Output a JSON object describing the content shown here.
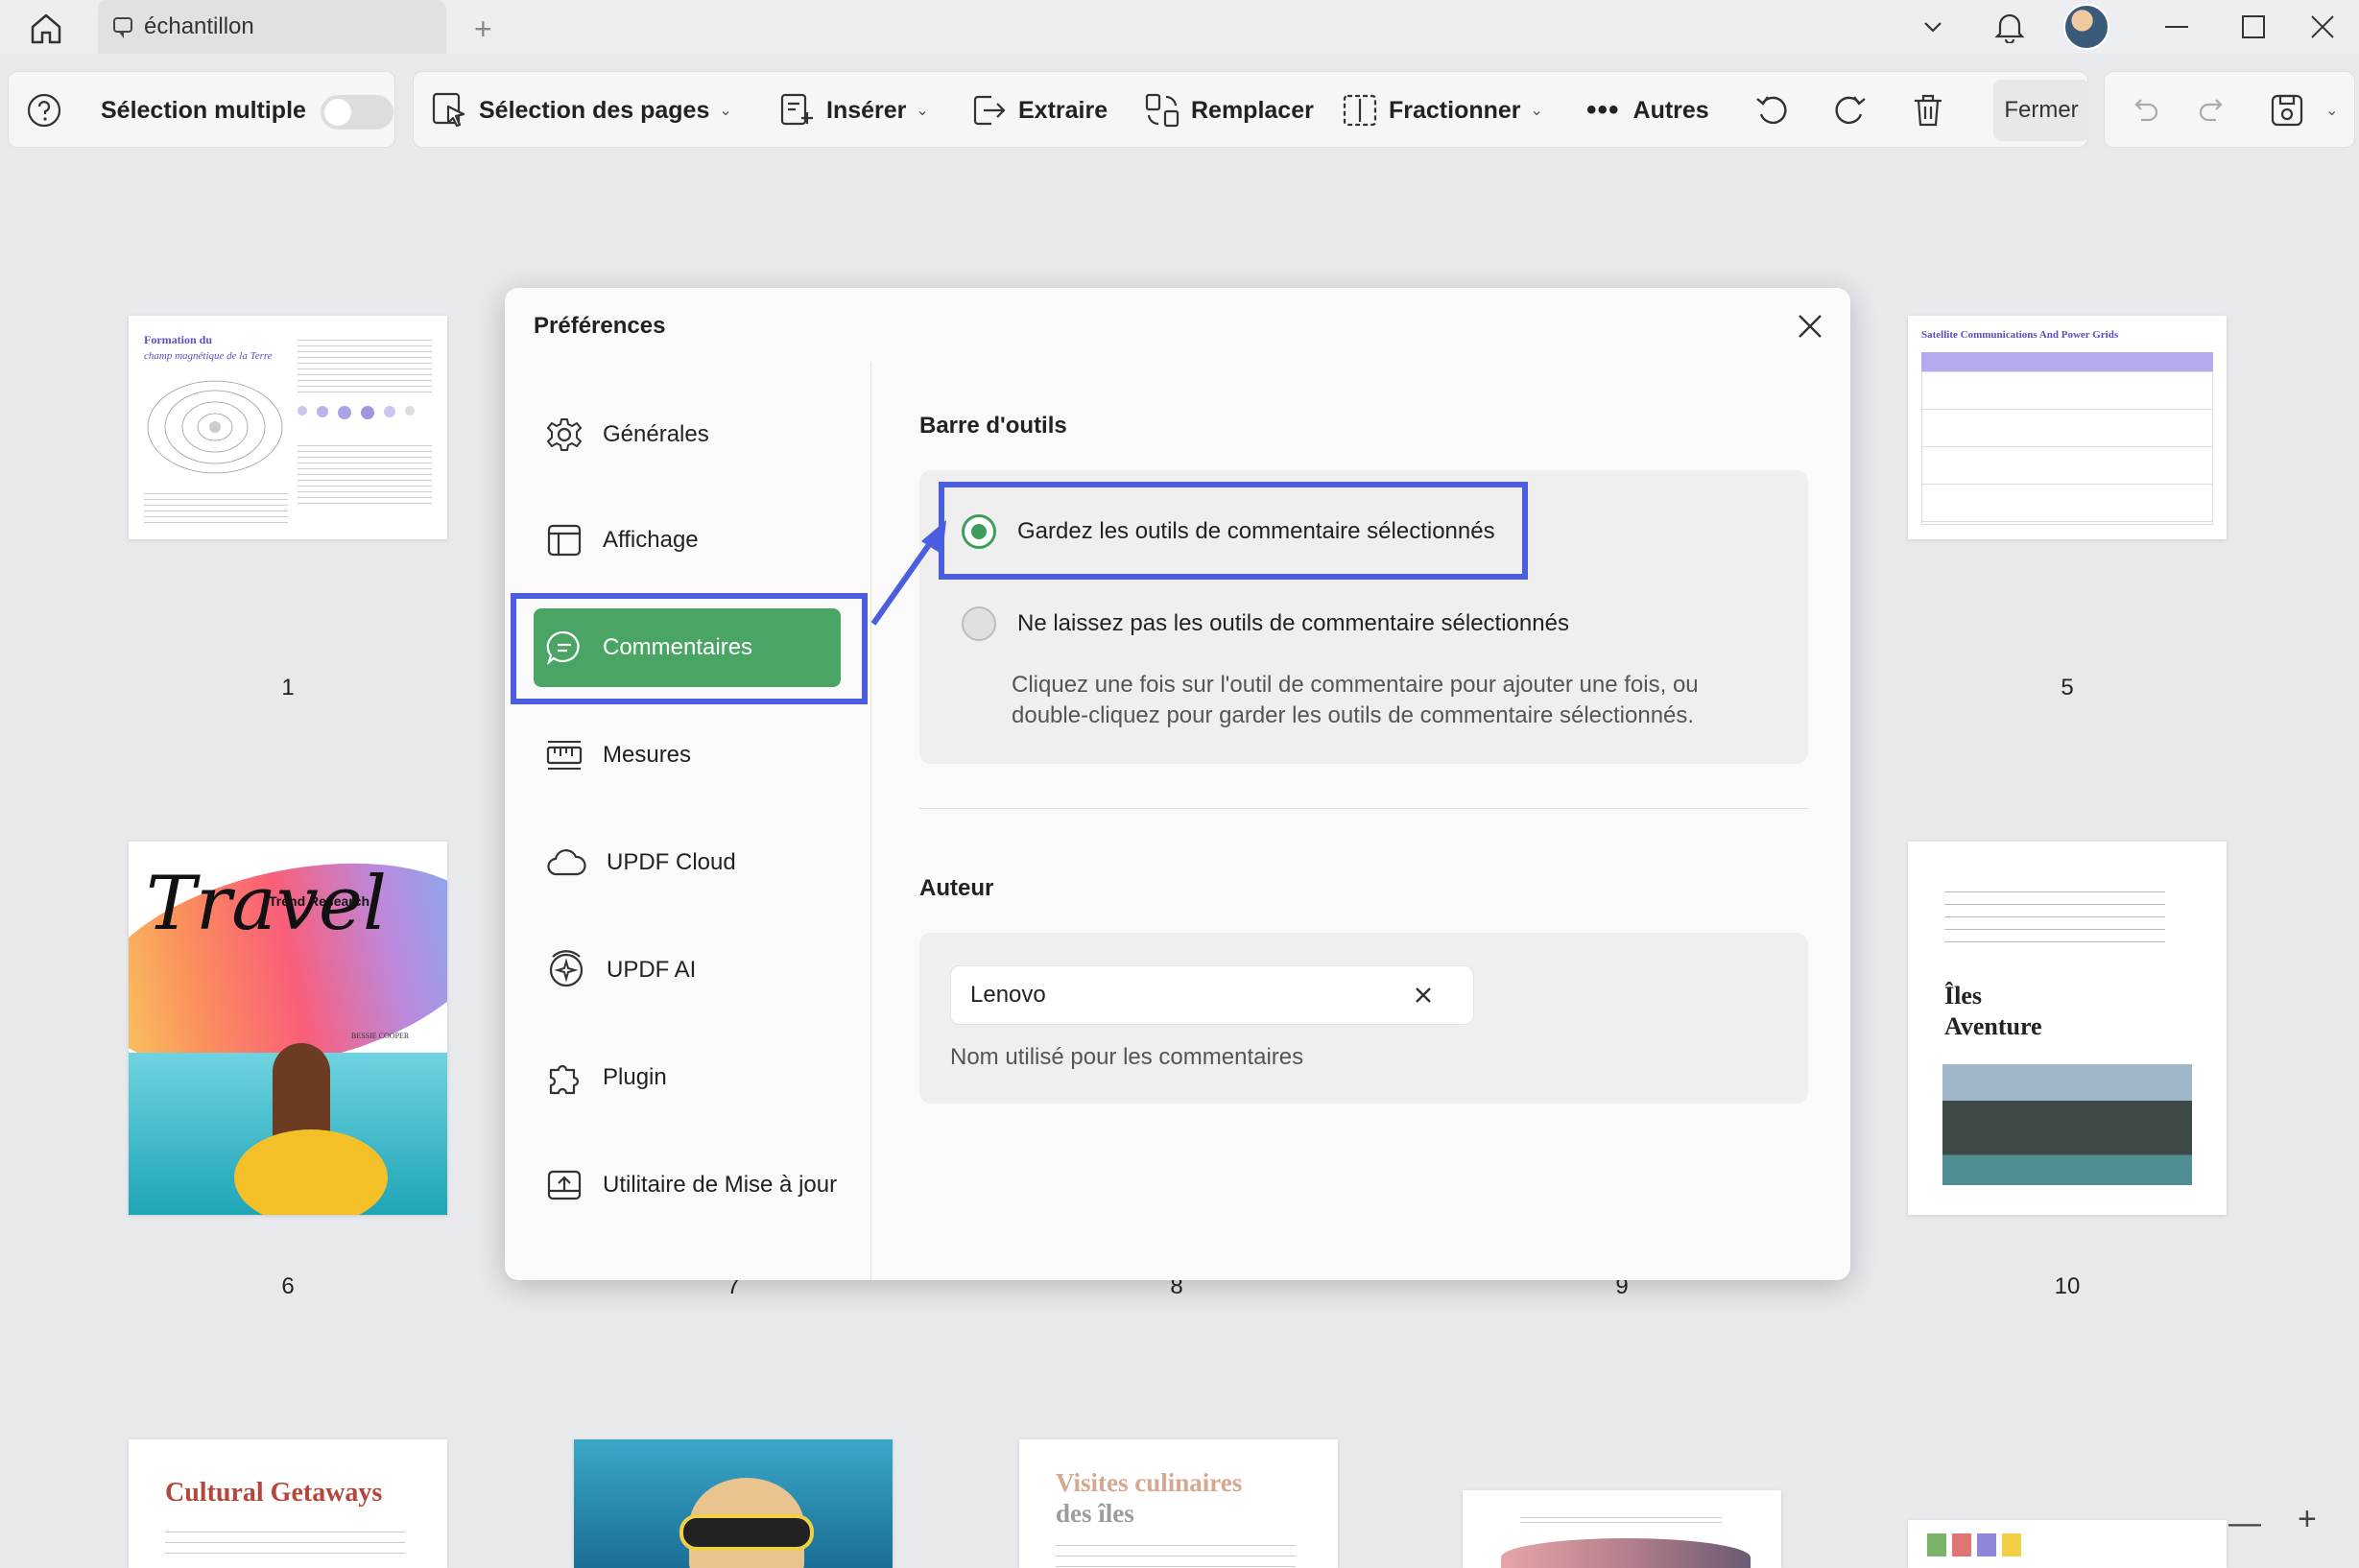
{
  "titlebar": {
    "tab_title": "échantillon",
    "add_tab_symbol": "+"
  },
  "toolbar": {
    "help_icon": "question-circle-icon",
    "multi_select_label": "Sélection multiple",
    "page_select_label": "Sélection des pages",
    "insert_label": "Insérer",
    "extract_label": "Extraire",
    "replace_label": "Remplacer",
    "split_label": "Fractionner",
    "more_label": "Autres",
    "close_label": "Fermer"
  },
  "thumbnails": {
    "page1": {
      "number": "1",
      "title_line1": "Formation du",
      "title_line2": "champ magnétique de la Terre"
    },
    "page5": {
      "number": "5",
      "title": "Satellite Communications And Power Grids"
    },
    "page6": {
      "number": "6",
      "title": "Travel",
      "subtitle": "Trend Research",
      "author": "BESSIE COOPER"
    },
    "page7": {
      "number": "7"
    },
    "page8": {
      "number": "8"
    },
    "page9": {
      "number": "9"
    },
    "page10": {
      "number": "10",
      "title_line1": "Îles",
      "title_line2": "Aventure"
    },
    "row3": {
      "cultural": "Cultural Getaways",
      "visites_line1": "Visites culinaires",
      "visites_line2": "des îles"
    }
  },
  "dialog": {
    "title": "Préférences",
    "nav": [
      {
        "label": "Générales"
      },
      {
        "label": "Affichage"
      },
      {
        "label": "Commentaires"
      },
      {
        "label": "Mesures"
      },
      {
        "label": "UPDF Cloud"
      },
      {
        "label": "UPDF AI"
      },
      {
        "label": "Plugin"
      },
      {
        "label": "Utilitaire de Mise à jour"
      }
    ],
    "toolbar_section": {
      "title": "Barre d'outils",
      "option_keep": "Gardez les outils de commentaire sélectionnés",
      "option_no_keep": "Ne laissez pas les outils de commentaire sélectionnés",
      "help_line1": "Cliquez une fois sur l'outil de commentaire pour ajouter une fois, ou",
      "help_line2": "double-cliquez pour garder les outils de commentaire sélectionnés."
    },
    "author_section": {
      "title": "Auteur",
      "value": "Lenovo",
      "help": "Nom utilisé pour les commentaires"
    }
  },
  "zoom": {
    "minus": "—",
    "plus": "+"
  },
  "colors": {
    "accent_green": "#4aa564",
    "highlight_blue": "#4b5ee0"
  }
}
